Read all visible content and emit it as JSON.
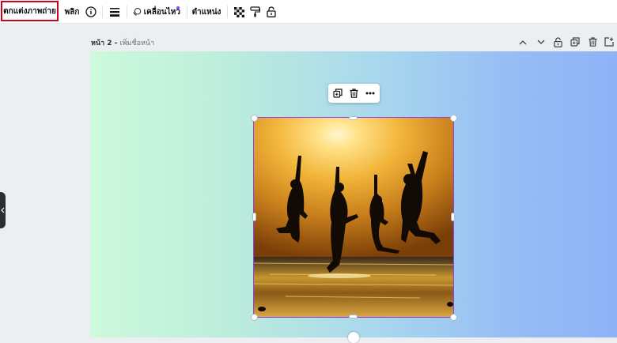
{
  "toolbar": {
    "edit_photo_label": "ตกแต่งภาพถ่าย",
    "flip_label": "พลิก",
    "animate_label": "เคลื่อนไหว",
    "position_label": "ตำแหน่ง",
    "icons": [
      "info-icon",
      "border-style-icon",
      "animate-icon",
      "transparency-icon",
      "copy-style-icon",
      "lock-icon"
    ],
    "new_feature_dot_color": "#8b3dff"
  },
  "page": {
    "number_label": "หน้า 2 - ",
    "title_placeholder": "เพิ่มชื่อหน้า",
    "actions": [
      "move-up-icon",
      "move-down-icon",
      "lock-icon",
      "duplicate-page-icon",
      "delete-page-icon",
      "add-page-icon"
    ]
  },
  "canvas": {
    "background_gradient": [
      "#cdfadc",
      "#8fb2f7"
    ],
    "selection_color": "#8b3dff"
  },
  "element_toolbar": {
    "actions": [
      "duplicate-icon",
      "delete-icon",
      "more-icon"
    ]
  }
}
